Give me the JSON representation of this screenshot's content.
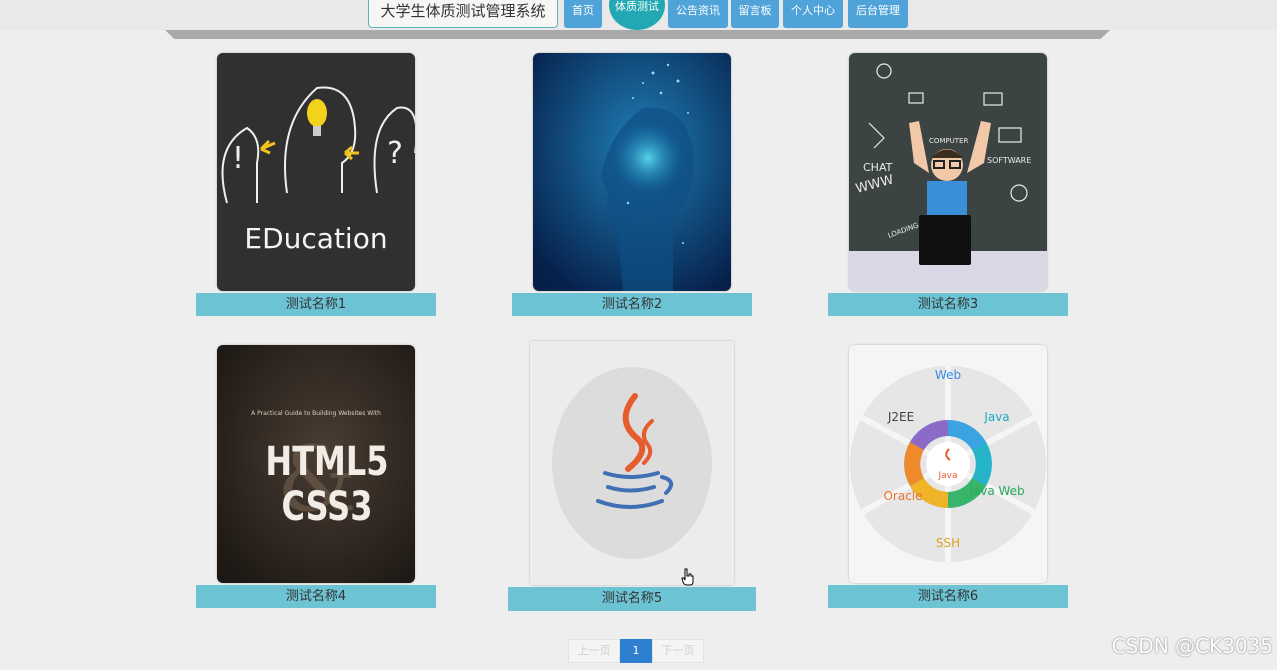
{
  "header": {
    "site_title": "大学生体质测试管理系统",
    "nav": [
      {
        "label": "首页"
      },
      {
        "label": "体质测试",
        "active": true
      },
      {
        "label": "公告资讯"
      },
      {
        "label": "留言板"
      },
      {
        "label": "个人中心"
      },
      {
        "label": "后台管理"
      }
    ]
  },
  "cards": [
    {
      "caption": "测试名称1",
      "image": "education-chalkboard",
      "image_text": "EDucation"
    },
    {
      "caption": "测试名称2",
      "image": "digital-head"
    },
    {
      "caption": "测试名称3",
      "image": "boy-chalkboard",
      "image_text": [
        "CHAT",
        "WWW",
        "COMPUTER",
        "SOFTWARE",
        "LOADING"
      ]
    },
    {
      "caption": "测试名称4",
      "image": "html5-css3-book",
      "image_text": [
        "A Practical Guide to Building Websites With",
        "HTML5",
        "CSS3"
      ]
    },
    {
      "caption": "测试名称5",
      "image": "java-logo"
    },
    {
      "caption": "测试名称6",
      "image": "java-tech-wheel",
      "image_text": [
        "Web",
        "Java",
        "Java Web",
        "SSH",
        "Oracle",
        "J2EE",
        "Java"
      ]
    }
  ],
  "pagination": {
    "prev_label": "上一页",
    "current_page": "1",
    "next_label": "下一页"
  },
  "watermark": "CSDN @CK3035",
  "colors": {
    "nav_button": "#4fa3d9",
    "nav_active": "#22a8b2",
    "caption_bar": "#6cc3d4",
    "page_current": "#2f7fd0"
  }
}
